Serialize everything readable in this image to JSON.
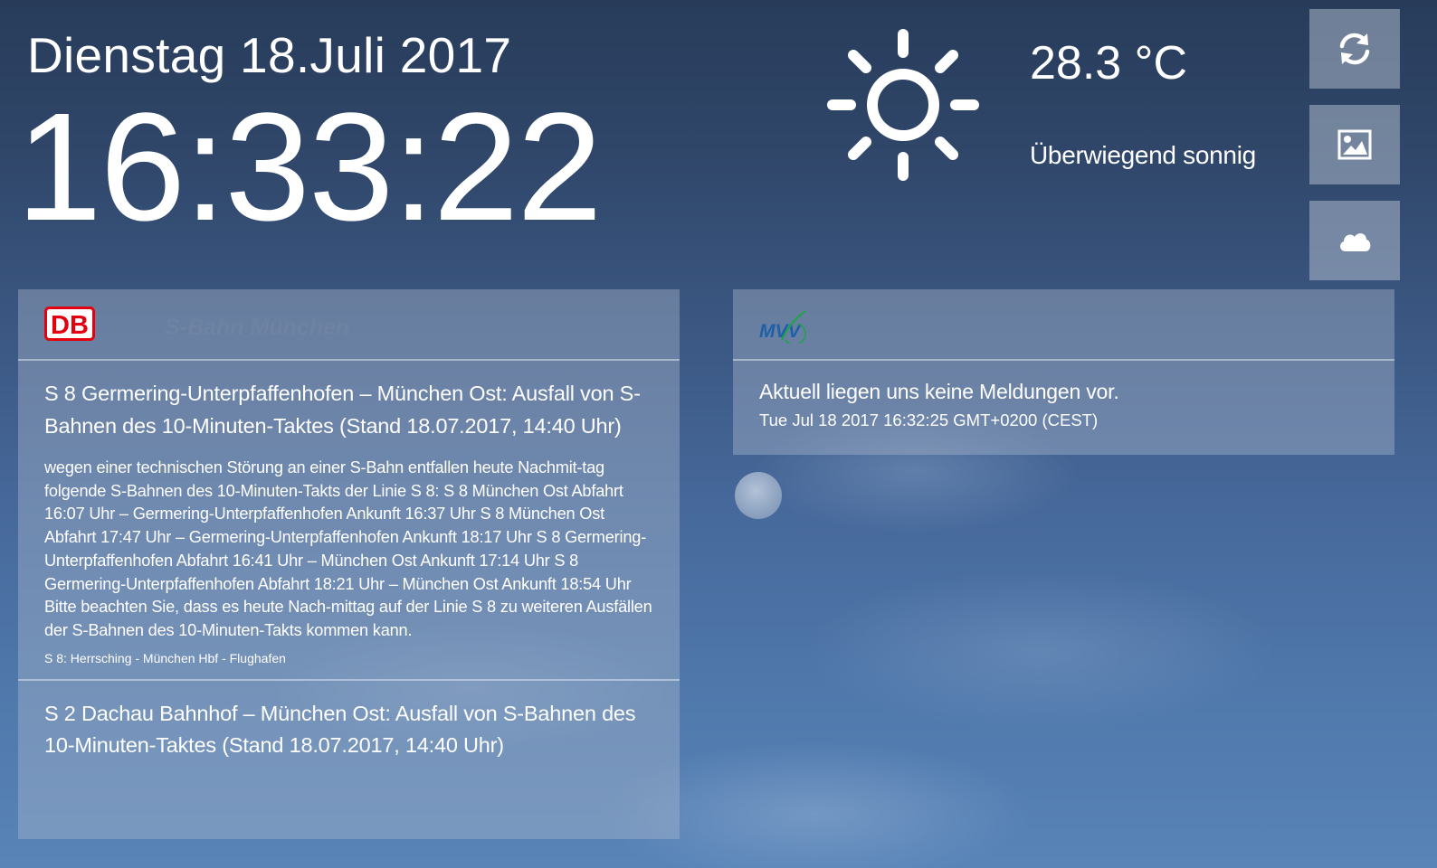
{
  "header": {
    "date": "Dienstag 18.Juli 2017",
    "time": "16:33:22"
  },
  "weather": {
    "icon": "sun-icon",
    "temperature": "28.3 °C",
    "condition": "Überwiegend sonnig"
  },
  "side_buttons": [
    {
      "icon": "refresh-icon"
    },
    {
      "icon": "image-icon"
    },
    {
      "icon": "cloud-icon"
    }
  ],
  "db_panel": {
    "logo_text": "DB",
    "subtitle": "S-Bahn München",
    "messages": [
      {
        "title": "S 8 Germering-Unterpfaffenhofen – München Ost: Ausfall von S-Bahnen des 10-Minuten-Taktes (Stand 18.07.2017, 14:40 Uhr)",
        "body": "wegen einer technischen Störung an einer S-Bahn entfallen heute Nachmit-tag folgende S-Bahnen des 10-Minuten-Takts der Linie S 8: S 8 München Ost Abfahrt 16:07 Uhr – Germering-Unterpfaffenhofen Ankunft 16:37 Uhr S 8 München Ost Abfahrt 17:47 Uhr – Germering-Unterpfaffenhofen Ankunft 18:17 Uhr S 8 Germering-Unterpfaffenhofen Abfahrt 16:41 Uhr – München Ost Ankunft 17:14 Uhr S 8 Germering-Unterpfaffenhofen Abfahrt 18:21 Uhr – München Ost Ankunft 18:54 Uhr Bitte beachten Sie, dass es heute Nach-mittag auf der Linie S 8 zu weiteren Ausfällen der S-Bahnen des 10-Minuten-Takts kommen kann.",
        "lines": "S 8: Herrsching - München Hbf - Flughafen"
      },
      {
        "title": "S 2 Dachau Bahnhof – München Ost: Ausfall von S-Bahnen des 10-Minuten-Taktes (Stand 18.07.2017, 14:40 Uhr)"
      }
    ]
  },
  "mvv_panel": {
    "logo_text": "MVV",
    "status": "Aktuell liegen uns keine Meldungen vor.",
    "timestamp": "Tue Jul 18 2017 16:32:25 GMT+0200 (CEST)"
  },
  "colors": {
    "db_red": "#e3000f",
    "mvv_blue": "#1f5fa8",
    "mvv_green": "#1fa34a"
  }
}
